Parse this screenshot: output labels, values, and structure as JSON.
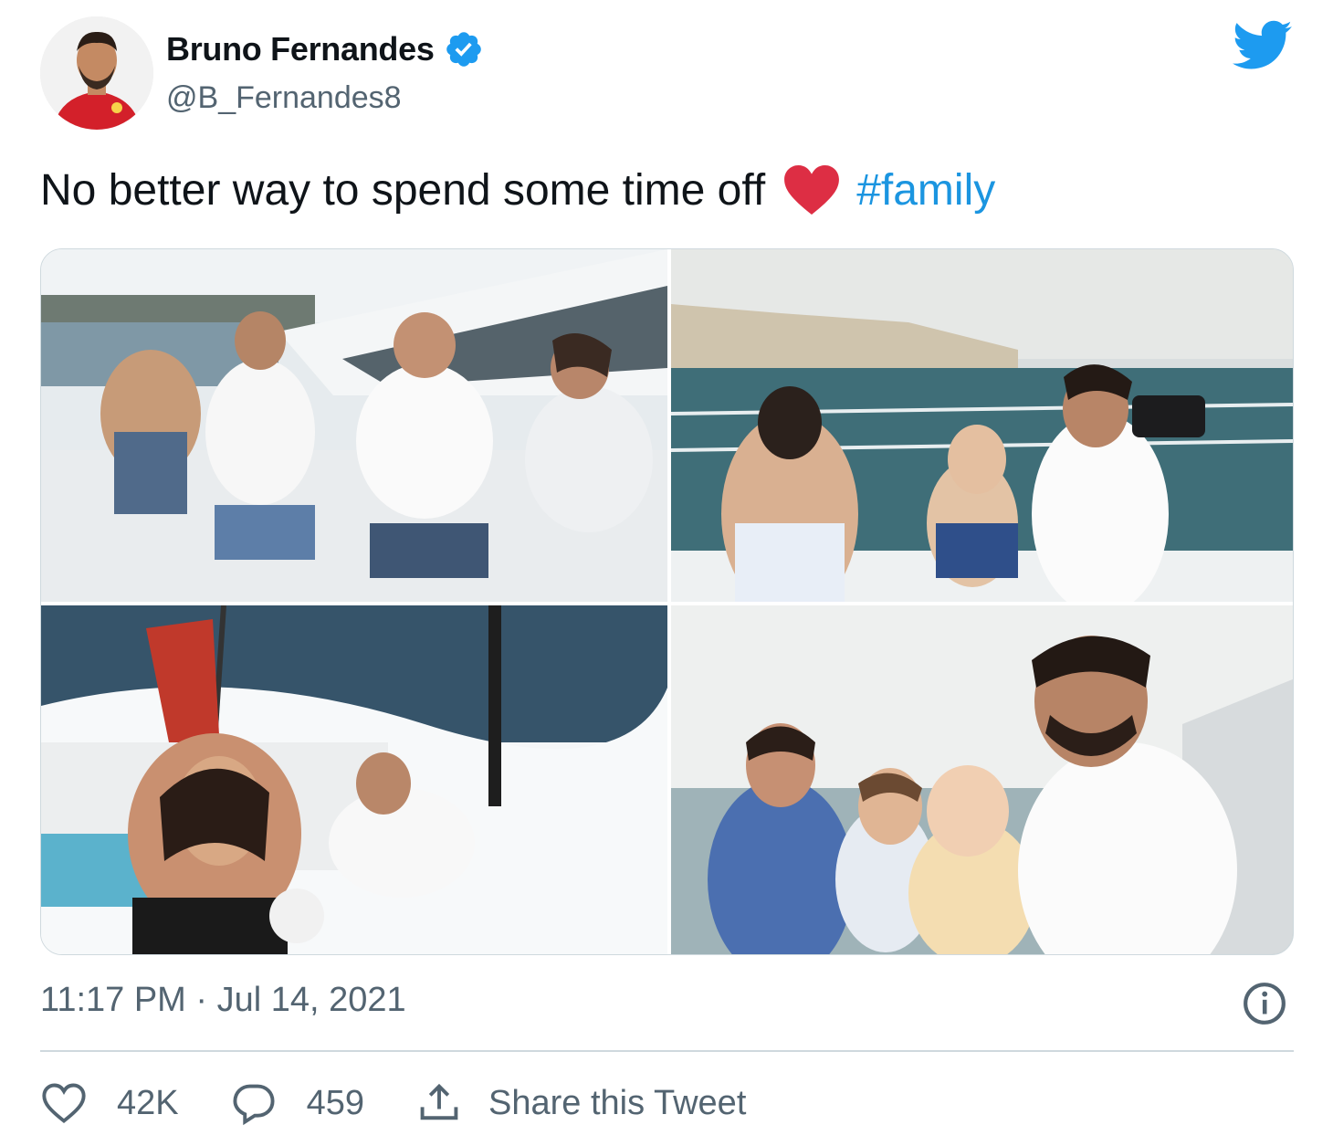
{
  "user": {
    "name": "Bruno Fernandes",
    "handle": "@B_Fernandes8",
    "avatar_icon": "profile-photo",
    "verified_icon": "verified-badge-icon"
  },
  "tweet": {
    "text": "No better way to spend some time off",
    "emoji": "red-heart",
    "hashtag": "#family",
    "timestamp": "11:17 PM · Jul 14, 2021"
  },
  "media": {
    "photos": [
      "family-boat-photo-1",
      "family-boat-photo-2",
      "family-boat-photo-3",
      "family-boat-photo-4"
    ]
  },
  "actions": {
    "likes": "42K",
    "replies": "459",
    "share_label": "Share this Tweet"
  },
  "colors": {
    "brand": "#1d9bf0",
    "hashtag": "#1b95e0",
    "muted": "#536471",
    "heart": "#e0245e"
  }
}
